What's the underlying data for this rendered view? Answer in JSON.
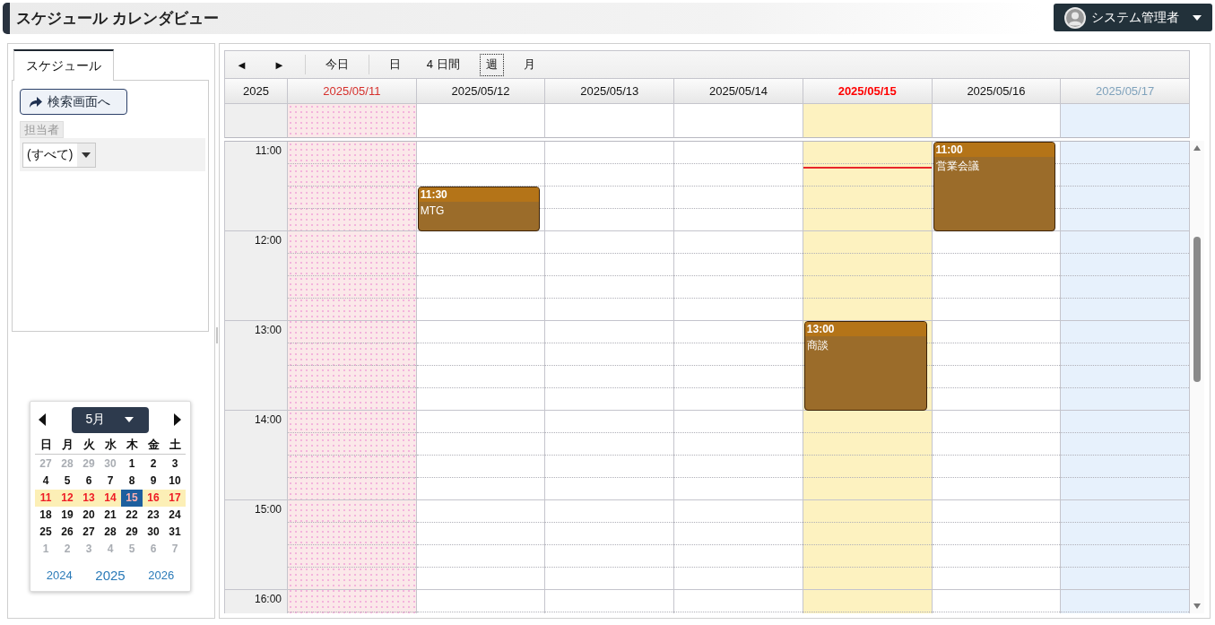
{
  "header": {
    "title": "スケジュール カレンダビュー",
    "user_menu": {
      "name": "システム管理者"
    }
  },
  "side_panel": {
    "tabs": [
      {
        "label": "スケジュール",
        "selected": true
      }
    ],
    "search_button": "検索画面へ",
    "assignee": {
      "label": "担当者",
      "value": "(すべて)"
    }
  },
  "mini_calendar": {
    "month": "5月",
    "weekdays": [
      "日",
      "月",
      "火",
      "水",
      "木",
      "金",
      "土"
    ],
    "weeks": [
      {
        "selected": false,
        "days": [
          {
            "day": "27",
            "kind": "outside",
            "selected": false
          },
          {
            "day": "28",
            "kind": "outside",
            "selected": false
          },
          {
            "day": "29",
            "kind": "outside",
            "selected": false
          },
          {
            "day": "30",
            "kind": "outside",
            "selected": false
          },
          {
            "day": "1",
            "kind": "month",
            "selected": false
          },
          {
            "day": "2",
            "kind": "month",
            "selected": false
          },
          {
            "day": "3",
            "kind": "month",
            "selected": false
          }
        ]
      },
      {
        "selected": false,
        "days": [
          {
            "day": "4",
            "kind": "month",
            "selected": false
          },
          {
            "day": "5",
            "kind": "month",
            "selected": false
          },
          {
            "day": "6",
            "kind": "month",
            "selected": false
          },
          {
            "day": "7",
            "kind": "month",
            "selected": false
          },
          {
            "day": "8",
            "kind": "month",
            "selected": false
          },
          {
            "day": "9",
            "kind": "month",
            "selected": false
          },
          {
            "day": "10",
            "kind": "month",
            "selected": false
          }
        ]
      },
      {
        "selected": true,
        "days": [
          {
            "day": "11",
            "kind": "month",
            "selected": false
          },
          {
            "day": "12",
            "kind": "month",
            "selected": false
          },
          {
            "day": "13",
            "kind": "month",
            "selected": false
          },
          {
            "day": "14",
            "kind": "month",
            "selected": false
          },
          {
            "day": "15",
            "kind": "month",
            "selected": true
          },
          {
            "day": "16",
            "kind": "month",
            "selected": false
          },
          {
            "day": "17",
            "kind": "month",
            "selected": false
          }
        ]
      },
      {
        "selected": false,
        "days": [
          {
            "day": "18",
            "kind": "month",
            "selected": false
          },
          {
            "day": "19",
            "kind": "month",
            "selected": false
          },
          {
            "day": "20",
            "kind": "month",
            "selected": false
          },
          {
            "day": "21",
            "kind": "month",
            "selected": false
          },
          {
            "day": "22",
            "kind": "month",
            "selected": false
          },
          {
            "day": "23",
            "kind": "month",
            "selected": false
          },
          {
            "day": "24",
            "kind": "month",
            "selected": false
          }
        ]
      },
      {
        "selected": false,
        "days": [
          {
            "day": "25",
            "kind": "month",
            "selected": false
          },
          {
            "day": "26",
            "kind": "month",
            "selected": false
          },
          {
            "day": "27",
            "kind": "month",
            "selected": false
          },
          {
            "day": "28",
            "kind": "month",
            "selected": false
          },
          {
            "day": "29",
            "kind": "month",
            "selected": false
          },
          {
            "day": "30",
            "kind": "month",
            "selected": false
          },
          {
            "day": "31",
            "kind": "month",
            "selected": false
          }
        ]
      },
      {
        "selected": false,
        "days": [
          {
            "day": "1",
            "kind": "outside",
            "selected": false
          },
          {
            "day": "2",
            "kind": "outside",
            "selected": false
          },
          {
            "day": "3",
            "kind": "outside",
            "selected": false
          },
          {
            "day": "4",
            "kind": "outside",
            "selected": false
          },
          {
            "day": "5",
            "kind": "outside",
            "selected": false
          },
          {
            "day": "6",
            "kind": "outside",
            "selected": false
          },
          {
            "day": "7",
            "kind": "outside",
            "selected": false
          }
        ]
      }
    ],
    "years": [
      {
        "label": "2024",
        "selected": false
      },
      {
        "label": "2025",
        "selected": true
      },
      {
        "label": "2026",
        "selected": false
      }
    ]
  },
  "calendar": {
    "toolbar": {
      "prev": "◄",
      "next": "►",
      "today": "今日",
      "views": [
        {
          "label": "日",
          "selected": false
        },
        {
          "label": "4 日間",
          "selected": false
        },
        {
          "label": "週",
          "selected": true
        },
        {
          "label": "月",
          "selected": false
        }
      ]
    },
    "year": "2025",
    "days": [
      {
        "date": "2025/05/11",
        "kind": "sunday",
        "now_line": false
      },
      {
        "date": "2025/05/12",
        "kind": "weekday",
        "now_line": false,
        "events": [
          {
            "time": "11:30",
            "title": "MTG"
          }
        ]
      },
      {
        "date": "2025/05/13",
        "kind": "weekday",
        "now_line": false
      },
      {
        "date": "2025/05/14",
        "kind": "weekday",
        "now_line": false
      },
      {
        "date": "2025/05/15",
        "kind": "today",
        "now_line": true,
        "events": [
          {
            "time": "13:00",
            "title": "商談"
          }
        ]
      },
      {
        "date": "2025/05/16",
        "kind": "weekday",
        "now_line": false,
        "events": [
          {
            "time": "11:00",
            "title": "営業会議"
          }
        ]
      },
      {
        "date": "2025/05/17",
        "kind": "saturday",
        "now_line": false
      }
    ],
    "times": [
      "11:00",
      "12:00",
      "13:00",
      "14:00",
      "15:00",
      "16:00"
    ]
  }
}
